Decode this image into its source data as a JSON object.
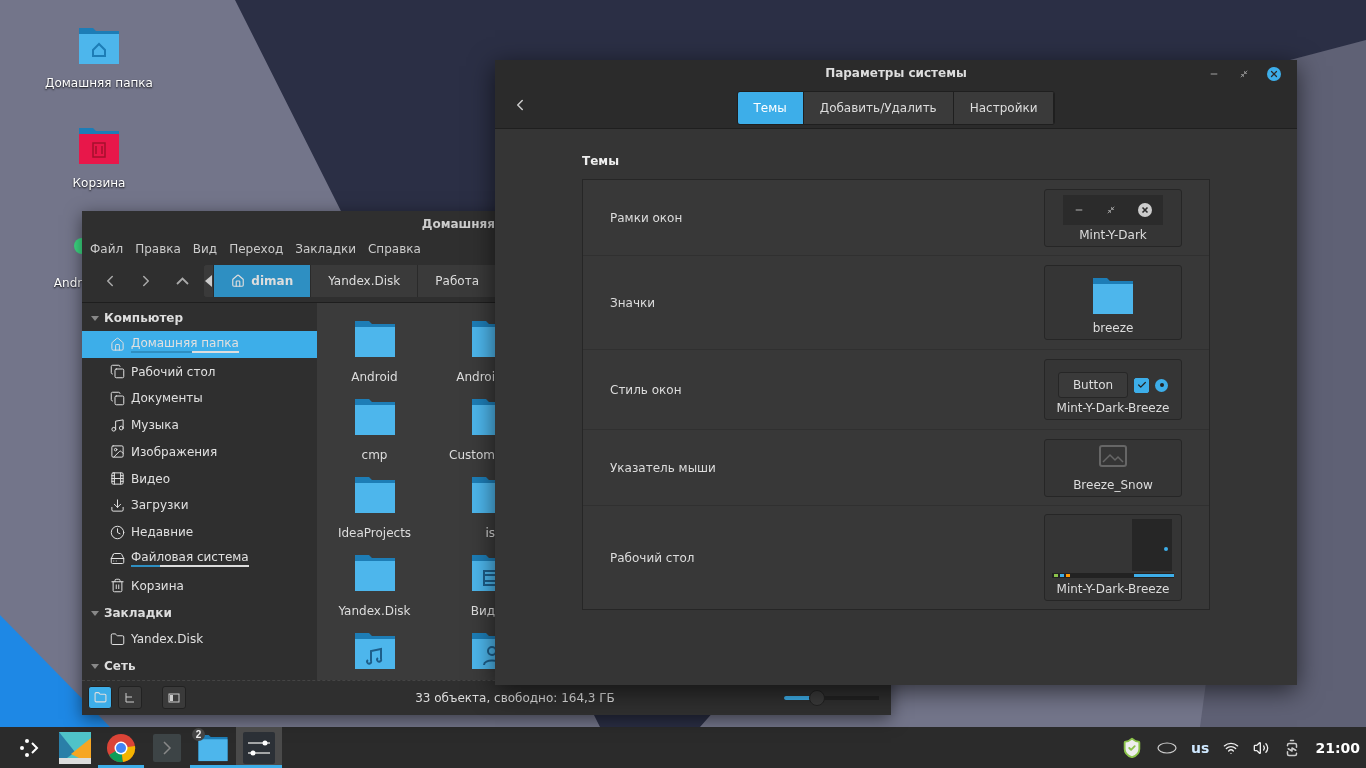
{
  "desktop": {
    "icons": [
      {
        "label": "Домашняя папка",
        "kind": "home"
      },
      {
        "label": "Корзина",
        "kind": "trash"
      },
      {
        "label": "Andr",
        "kind": "app"
      }
    ]
  },
  "file_manager": {
    "title": "Домашняя",
    "menu": [
      "Файл",
      "Правка",
      "Вид",
      "Переход",
      "Закладки",
      "Справка"
    ],
    "breadcrumb": [
      {
        "label": "diman",
        "selected": true,
        "kind": "home"
      },
      {
        "label": "Yandex.Disk",
        "selected": false
      },
      {
        "label": "Работа",
        "selected": false
      }
    ],
    "sidebar": [
      {
        "heading": "Компьютер",
        "expanded": true,
        "items": [
          {
            "label": "Домашняя папка",
            "kind": "home",
            "selected": true,
            "level": 0.57
          },
          {
            "label": "Рабочий стол",
            "kind": "copy",
            "selected": false
          },
          {
            "label": "Документы",
            "kind": "copy",
            "selected": false
          },
          {
            "label": "Музыка",
            "kind": "music",
            "selected": false
          },
          {
            "label": "Изображения",
            "kind": "image",
            "selected": false
          },
          {
            "label": "Видео",
            "kind": "film",
            "selected": false
          },
          {
            "label": "Загрузки",
            "kind": "download",
            "selected": false
          },
          {
            "label": "Недавние",
            "kind": "clock",
            "selected": false
          },
          {
            "label": "Файловая система",
            "kind": "drive",
            "selected": false,
            "level": 0.25
          },
          {
            "label": "Корзина",
            "kind": "trash",
            "selected": false
          }
        ]
      },
      {
        "heading": "Закладки",
        "expanded": true,
        "items": [
          {
            "label": "Yandex.Disk",
            "kind": "folder",
            "selected": false
          }
        ]
      },
      {
        "heading": "Сеть",
        "expanded": true
      }
    ],
    "files": [
      {
        "label": "Android",
        "kind": "folder"
      },
      {
        "label": "Androi",
        "kind": "folder"
      },
      {
        "label": "cmp",
        "kind": "folder"
      },
      {
        "label": "Custom",
        "kind": "folder"
      },
      {
        "label": "IdeaProjects",
        "kind": "folder"
      },
      {
        "label": "is",
        "kind": "folder"
      },
      {
        "label": "Yandex.Disk",
        "kind": "folder"
      },
      {
        "label": "Вид",
        "kind": "video"
      },
      {
        "kind": "music"
      },
      {
        "kind": "user"
      }
    ],
    "view_buttons": [
      {
        "kind": "icons",
        "selected": true
      },
      {
        "kind": "tree",
        "selected": false
      },
      {
        "kind": "panel",
        "selected": false
      }
    ],
    "status": "33 объекта, свободно: 164,3 ГБ",
    "zoom": {
      "level": 0.34
    }
  },
  "settings": {
    "title": "Параметры системы",
    "tabs": [
      {
        "label": "Темы",
        "selected": true
      },
      {
        "label": "Добавить/Удалить",
        "selected": false
      },
      {
        "label": "Настройки",
        "selected": false
      }
    ],
    "section": "Темы",
    "rows": [
      {
        "label": "Рамки окон",
        "kind": "window-buttons",
        "value": "Mint-Y-Dark"
      },
      {
        "label": "Значки",
        "kind": "icon",
        "value": "breeze"
      },
      {
        "label": "Стиль окон",
        "kind": "controls",
        "value": "Mint-Y-Dark-Breeze",
        "button": "Button",
        "checked": true,
        "radio_selected": true
      },
      {
        "label": "Указатель мыши",
        "kind": "cursor",
        "value": "Breeze_Snow"
      },
      {
        "label": "Рабочий стол",
        "kind": "desktop",
        "value": "Mint-Y-Dark-Breeze"
      }
    ]
  },
  "taskbar": {
    "apps": [
      {
        "kind": "kite",
        "running": false,
        "active": false
      },
      {
        "kind": "chrome",
        "running": true,
        "active": false
      },
      {
        "kind": "terminal",
        "running": false,
        "active": false
      },
      {
        "kind": "files",
        "running": true,
        "active": false,
        "badge": "2"
      },
      {
        "kind": "settings",
        "running": true,
        "active": true
      }
    ],
    "layout": "us",
    "clock": "21:00"
  }
}
